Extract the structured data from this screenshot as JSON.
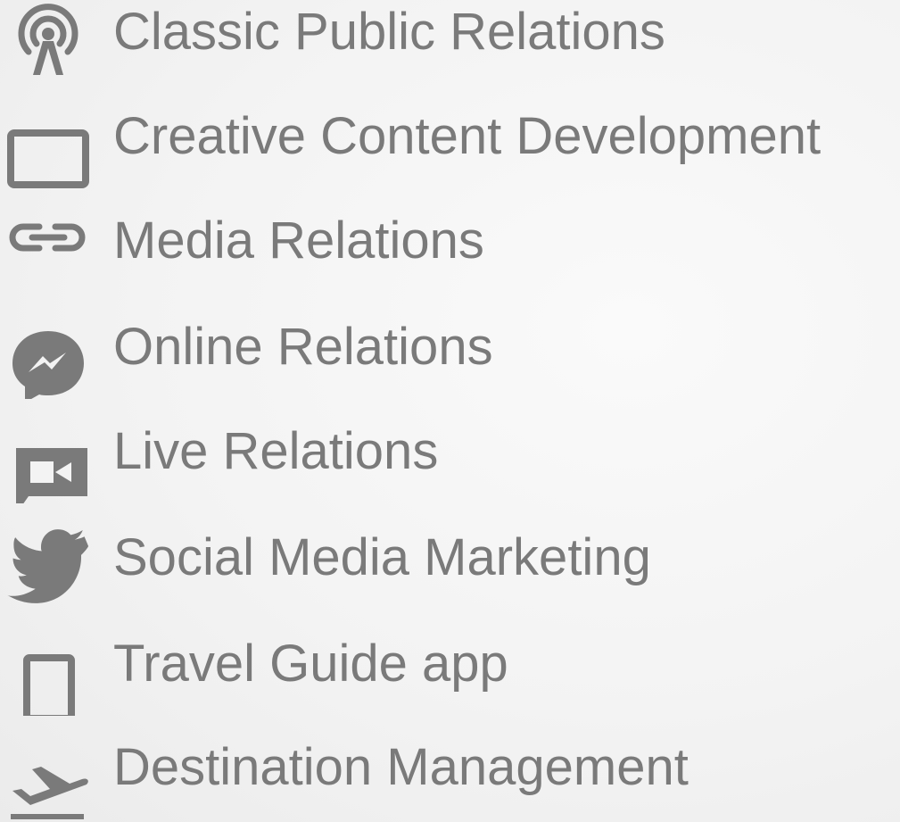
{
  "services": [
    {
      "label": "Classic Public Relations",
      "icon": "podcast-icon"
    },
    {
      "label": "Creative Content Development",
      "icon": "monitor-icon"
    },
    {
      "label": "Media Relations",
      "icon": "link-icon"
    },
    {
      "label": "Online Relations",
      "icon": "messenger-icon"
    },
    {
      "label": "Live Relations",
      "icon": "video-chat-icon"
    },
    {
      "label": "Social Media Marketing",
      "icon": "twitter-icon"
    },
    {
      "label": "Travel Guide app",
      "icon": "tablet-icon"
    },
    {
      "label": "Destination Management",
      "icon": "airplane-takeoff-icon"
    }
  ],
  "colors": {
    "icon": "#7a7a7a",
    "text": "#7a7a7a",
    "background": "#f3f3f3"
  }
}
